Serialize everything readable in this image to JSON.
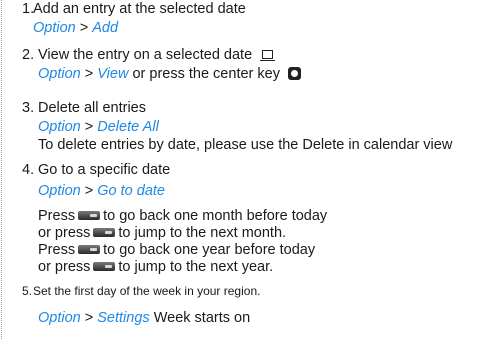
{
  "items": [
    {
      "number": "1.",
      "title": "Add an entry at the selected date",
      "nav": {
        "option": "Option",
        "sep": ">",
        "target": "Add"
      }
    },
    {
      "number": "2.",
      "title": "View the entry on a selected date",
      "nav": {
        "option": "Option",
        "sep": ">",
        "target": "View",
        "tail": "or press the center key"
      }
    },
    {
      "number": "3.",
      "title": "Delete all entries",
      "nav": {
        "option": "Option",
        "sep": ">",
        "target": "Delete All"
      },
      "note": "To delete entries by date, please use the Delete in calendar view"
    },
    {
      "number": "4.",
      "title": "Go to a specific date",
      "nav": {
        "option": "Option",
        "sep": ">",
        "target": "Go to date"
      },
      "lines": [
        {
          "before": "Press",
          "after": "to go back one month before today"
        },
        {
          "before": "or press",
          "after": "to jump to the next month."
        },
        {
          "before": "Press",
          "after": "to go back one year before today"
        },
        {
          "before": "or press",
          "after": "to jump to the next year."
        }
      ]
    },
    {
      "number": "5.",
      "title": "Set the first day of the week in your region.",
      "nav": {
        "option": "Option",
        "sep": ">",
        "target": "Settings",
        "tail": "Week starts on"
      }
    }
  ],
  "icons": {
    "view": "screen-icon",
    "center_key": "center-key-icon",
    "keys": [
      "key-7-icon",
      "key-9-icon",
      "key-1-icon",
      "key-3-icon"
    ]
  },
  "colors": {
    "nav": "#1e88e5",
    "text": "#1a1a1a"
  }
}
